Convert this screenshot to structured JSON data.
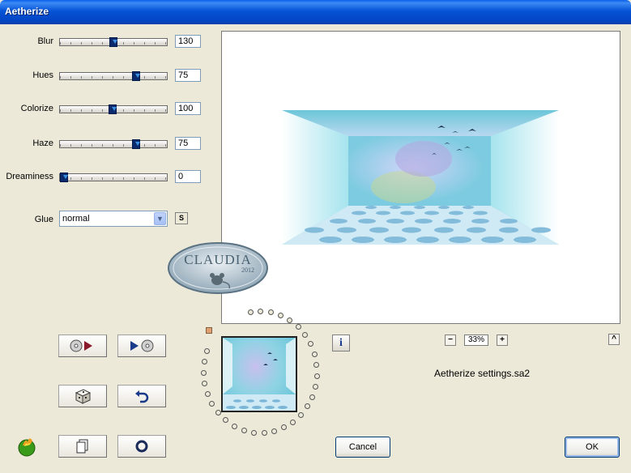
{
  "window": {
    "title": "Aetherize"
  },
  "sliders": [
    {
      "label": "Blur",
      "value": "130",
      "fraction": 0.5
    },
    {
      "label": "Hues",
      "value": "75",
      "fraction": 0.73
    },
    {
      "label": "Colorize",
      "value": "100",
      "fraction": 0.49
    },
    {
      "label": "Haze",
      "value": "75",
      "fraction": 0.73
    },
    {
      "label": "Dreaminess",
      "value": "0",
      "fraction": 0.0
    }
  ],
  "glue": {
    "label": "Glue",
    "value": "normal"
  },
  "sync_button": "S",
  "zoom": {
    "value": "33%",
    "minus": "−",
    "plus": "+"
  },
  "expand_button": "^",
  "info_button": "i",
  "settings_file": "Aetherize settings.sa2",
  "watermark": {
    "line1": "CLAUDIA",
    "line2": "2012"
  },
  "buttons": {
    "cancel": "Cancel",
    "ok": "OK"
  },
  "colors": {
    "title_bar": "#0653d6",
    "dialog_bg": "#ece9d8",
    "accent_orange": "#e0a070"
  }
}
